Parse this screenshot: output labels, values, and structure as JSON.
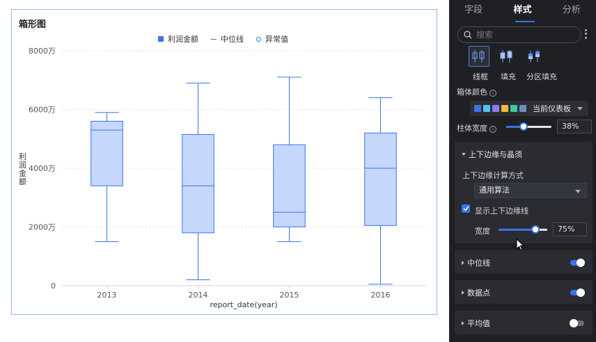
{
  "chart": {
    "title": "箱形图",
    "legend": {
      "box": "利润金额",
      "median": "中位线",
      "outlier": "异常值"
    },
    "ylabel": "利润金额",
    "xlabel": "report_date(year)"
  },
  "chart_data": {
    "type": "boxplot",
    "title": "箱形图",
    "xlabel": "report_date(year)",
    "ylabel": "利润金额",
    "categories": [
      "2013",
      "2014",
      "2015",
      "2016"
    ],
    "yticks": [
      "0",
      "2000万",
      "4000万",
      "6000万",
      "8000万"
    ],
    "ylim": [
      0,
      8000
    ],
    "y_unit": "万",
    "series": [
      {
        "name": "利润金额",
        "values": [
          {
            "min": 1500,
            "q1": 3400,
            "median": 5300,
            "q3": 5600,
            "max": 5900
          },
          {
            "min": 200,
            "q1": 1800,
            "median": 3400,
            "q3": 5150,
            "max": 6900
          },
          {
            "min": 1500,
            "q1": 2000,
            "median": 2500,
            "q3": 4800,
            "max": 7100
          },
          {
            "min": 50,
            "q1": 2050,
            "median": 4000,
            "q3": 5200,
            "max": 6400
          }
        ]
      }
    ],
    "grid": true,
    "legend_position": "top-center",
    "colors": {
      "box_fill": "#c5d7fb",
      "stroke": "#3a74e8"
    }
  },
  "panel": {
    "tabs": [
      "字段",
      "样式",
      "分析"
    ],
    "active_tab": "样式",
    "search_placeholder": "搜索",
    "box_style_options": [
      "线框",
      "填充",
      "分区填充"
    ],
    "box_color": {
      "label": "箱体颜色",
      "swatches": [
        "#3a74e8",
        "#53c4f0",
        "#8f7cf0",
        "#f2b93c",
        "#3ec7a0",
        "#6f8fbf"
      ],
      "value": "当前仪表板"
    },
    "column_width": {
      "label": "柱体宽度",
      "value": "38%",
      "fraction": 0.38
    },
    "whisker_section": {
      "title": "上下边缘与晶须",
      "calc_label": "上下边缘计算方式",
      "calc_value": "通用算法",
      "show_whisker_label": "显示上下边缘线",
      "show_whisker": true,
      "width_label": "宽度",
      "width_value": "75%",
      "width_fraction": 0.75
    },
    "sections": [
      {
        "title": "中位线",
        "on": true
      },
      {
        "title": "数据点",
        "on": true
      },
      {
        "title": "平均值",
        "on": false
      }
    ]
  }
}
